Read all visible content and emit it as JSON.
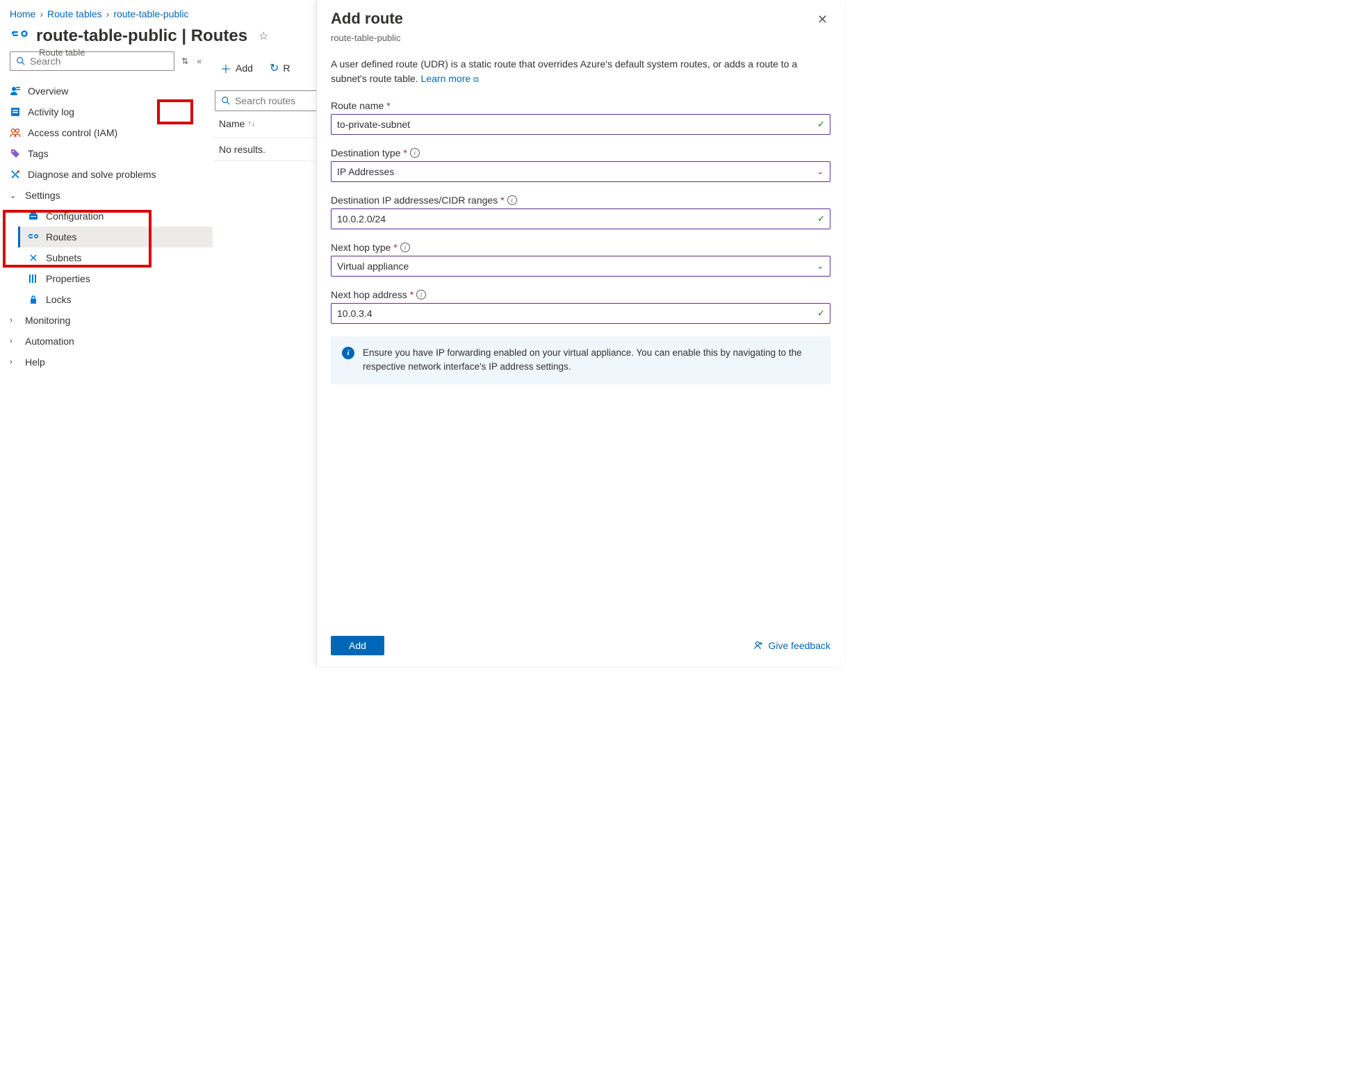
{
  "breadcrumb": {
    "home": "Home",
    "level1": "Route tables",
    "level2": "route-table-public"
  },
  "header": {
    "title": "route-table-public | Routes",
    "subtitle": "Route table"
  },
  "search": {
    "placeholder": "Search"
  },
  "nav": {
    "overview": "Overview",
    "activity": "Activity log",
    "iam": "Access control (IAM)",
    "tags": "Tags",
    "diagnose": "Diagnose and solve problems",
    "settings": "Settings",
    "configuration": "Configuration",
    "routes": "Routes",
    "subnets": "Subnets",
    "properties": "Properties",
    "locks": "Locks",
    "monitoring": "Monitoring",
    "automation": "Automation",
    "help": "Help"
  },
  "toolbar": {
    "add": "Add",
    "refresh": "R"
  },
  "table": {
    "search_placeholder": "Search routes",
    "col_name": "Name",
    "no_results": "No results."
  },
  "blade": {
    "title": "Add route",
    "subtitle": "route-table-public",
    "desc_prefix": "A user defined route (UDR) is a static route that overrides Azure's default system routes, or adds a route to a subnet's route table. ",
    "learn_more": "Learn more",
    "fields": {
      "route_name": {
        "label": "Route name",
        "value": "to-private-subnet"
      },
      "dest_type": {
        "label": "Destination type",
        "value": "IP Addresses"
      },
      "dest_cidr": {
        "label": "Destination IP addresses/CIDR ranges",
        "value": "10.0.2.0/24"
      },
      "hop_type": {
        "label": "Next hop type",
        "value": "Virtual appliance"
      },
      "hop_addr": {
        "label": "Next hop address",
        "value": "10.0.3.4"
      }
    },
    "info": "Ensure you have IP forwarding enabled on your virtual appliance. You can enable this by navigating to the respective network interface's IP address settings.",
    "add_btn": "Add",
    "feedback": "Give feedback"
  }
}
